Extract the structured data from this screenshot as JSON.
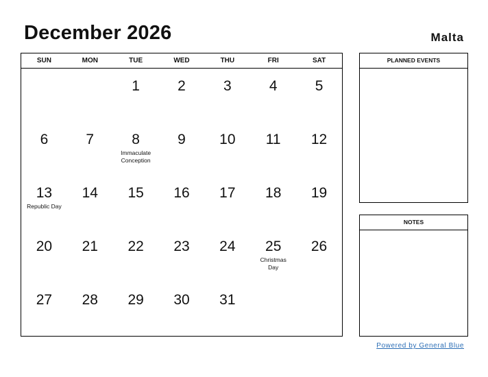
{
  "header": {
    "title": "December 2026",
    "country": "Malta"
  },
  "calendar": {
    "weekdays": [
      "SUN",
      "MON",
      "TUE",
      "WED",
      "THU",
      "FRI",
      "SAT"
    ],
    "weeks": [
      [
        {
          "day": ""
        },
        {
          "day": ""
        },
        {
          "day": "1"
        },
        {
          "day": "2"
        },
        {
          "day": "3"
        },
        {
          "day": "4"
        },
        {
          "day": "5"
        }
      ],
      [
        {
          "day": "6"
        },
        {
          "day": "7"
        },
        {
          "day": "8",
          "holiday": "Immaculate Conception"
        },
        {
          "day": "9"
        },
        {
          "day": "10"
        },
        {
          "day": "11"
        },
        {
          "day": "12"
        }
      ],
      [
        {
          "day": "13",
          "holiday": "Republic Day"
        },
        {
          "day": "14"
        },
        {
          "day": "15"
        },
        {
          "day": "16"
        },
        {
          "day": "17"
        },
        {
          "day": "18"
        },
        {
          "day": "19"
        }
      ],
      [
        {
          "day": "20"
        },
        {
          "day": "21"
        },
        {
          "day": "22"
        },
        {
          "day": "23"
        },
        {
          "day": "24"
        },
        {
          "day": "25",
          "holiday": "Christmas Day"
        },
        {
          "day": "26"
        }
      ],
      [
        {
          "day": "27"
        },
        {
          "day": "28"
        },
        {
          "day": "29"
        },
        {
          "day": "30"
        },
        {
          "day": "31"
        },
        {
          "day": ""
        },
        {
          "day": ""
        }
      ]
    ]
  },
  "panels": {
    "planned_events": "PLANNED EVENTS",
    "notes": "NOTES"
  },
  "footer": {
    "powered_by": "Powered by General Blue",
    "link_color": "#2a6db5"
  }
}
